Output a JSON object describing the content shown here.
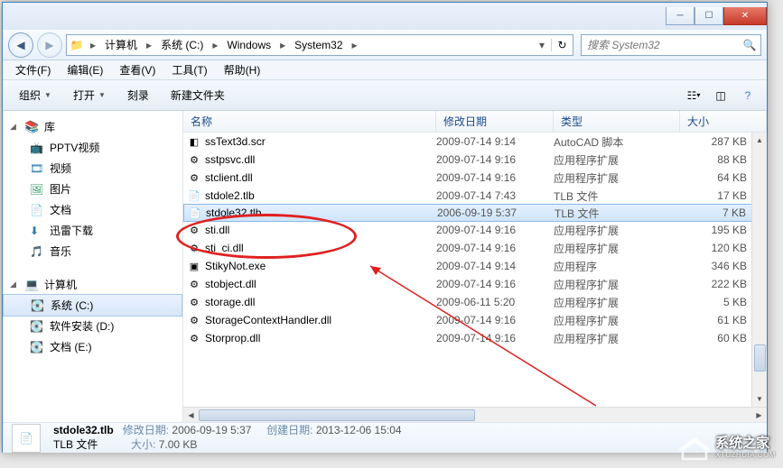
{
  "breadcrumb": {
    "icon": "folder",
    "segs": [
      "计算机",
      "系统 (C:)",
      "Windows",
      "System32"
    ]
  },
  "search": {
    "placeholder": "搜索 System32"
  },
  "menus": [
    "文件(F)",
    "编辑(E)",
    "查看(V)",
    "工具(T)",
    "帮助(H)"
  ],
  "toolbar": {
    "organize": "组织",
    "open": "打开",
    "burn": "刻录",
    "newfolder": "新建文件夹"
  },
  "sidebar": {
    "libs": {
      "label": "库",
      "items": [
        {
          "icon": "📺",
          "label": "PPTV视频",
          "c": "#2a7aad"
        },
        {
          "icon": "🎞",
          "label": "视频",
          "c": "#2a7aad"
        },
        {
          "icon": "🖼",
          "label": "图片",
          "c": "#2a9a5a"
        },
        {
          "icon": "📄",
          "label": "文档",
          "c": "#2a7aad"
        },
        {
          "icon": "⬇",
          "label": "迅雷下载",
          "c": "#2a7aad"
        },
        {
          "icon": "🎵",
          "label": "音乐",
          "c": "#2a7aad"
        }
      ]
    },
    "comp": {
      "label": "计算机",
      "items": [
        {
          "icon": "💽",
          "label": "系统 (C:)",
          "sel": true
        },
        {
          "icon": "💽",
          "label": "软件安装 (D:)"
        },
        {
          "icon": "💽",
          "label": "文档 (E:)"
        }
      ]
    }
  },
  "columns": {
    "name": "名称",
    "date": "修改日期",
    "type": "类型",
    "size": "大小"
  },
  "files": [
    {
      "i": "scr",
      "n": "ssText3d.scr",
      "d": "2009-07-14 9:14",
      "t": "AutoCAD 脚本",
      "s": "287 KB"
    },
    {
      "i": "dll",
      "n": "sstpsvc.dll",
      "d": "2009-07-14 9:16",
      "t": "应用程序扩展",
      "s": "88 KB"
    },
    {
      "i": "dll",
      "n": "stclient.dll",
      "d": "2009-07-14 9:16",
      "t": "应用程序扩展",
      "s": "64 KB"
    },
    {
      "i": "tlb",
      "n": "stdole2.tlb",
      "d": "2009-07-14 7:43",
      "t": "TLB 文件",
      "s": "17 KB"
    },
    {
      "i": "tlb",
      "n": "stdole32.tlb",
      "d": "2006-09-19 5:37",
      "t": "TLB 文件",
      "s": "7 KB",
      "sel": true
    },
    {
      "i": "dll",
      "n": "sti.dll",
      "d": "2009-07-14 9:16",
      "t": "应用程序扩展",
      "s": "195 KB"
    },
    {
      "i": "dll",
      "n": "sti_ci.dll",
      "d": "2009-07-14 9:16",
      "t": "应用程序扩展",
      "s": "120 KB"
    },
    {
      "i": "exe",
      "n": "StikyNot.exe",
      "d": "2009-07-14 9:14",
      "t": "应用程序",
      "s": "346 KB"
    },
    {
      "i": "dll",
      "n": "stobject.dll",
      "d": "2009-07-14 9:16",
      "t": "应用程序扩展",
      "s": "222 KB"
    },
    {
      "i": "dll",
      "n": "storage.dll",
      "d": "2009-06-11 5:20",
      "t": "应用程序扩展",
      "s": "5 KB"
    },
    {
      "i": "dll",
      "n": "StorageContextHandler.dll",
      "d": "2009-07-14 9:16",
      "t": "应用程序扩展",
      "s": "61 KB"
    },
    {
      "i": "dll",
      "n": "Storprop.dll",
      "d": "2009-07-14 9:16",
      "t": "应用程序扩展",
      "s": "60 KB"
    }
  ],
  "status": {
    "name": "stdole32.tlb",
    "type": "TLB 文件",
    "mod_k": "修改日期:",
    "mod_v": "2006-09-19 5:37",
    "crt_k": "创建日期:",
    "crt_v": "2013-12-06 15:04",
    "siz_k": "大小:",
    "siz_v": "7.00 KB"
  },
  "watermark": {
    "cn": "系统之家",
    "en": "XTCZHUIA.COM"
  },
  "icons": {
    "scr": "◧",
    "dll": "⚙",
    "tlb": "📄",
    "exe": "▣"
  }
}
